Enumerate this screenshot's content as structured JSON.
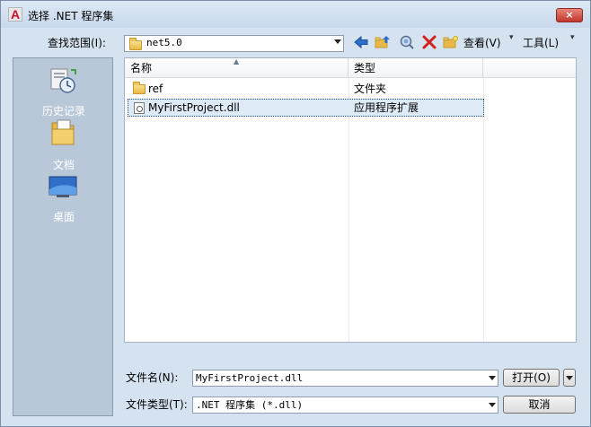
{
  "window": {
    "title": "选择 .NET 程序集",
    "close_icon": "×"
  },
  "lookin": {
    "label": "查找范围(I):",
    "value": "net5.0"
  },
  "toolbar": {
    "view_label": "查看(V)",
    "tools_label": "工具(L)"
  },
  "places": [
    {
      "label": "历史记录",
      "icon": "history-icon"
    },
    {
      "label": "文档",
      "icon": "documents-icon"
    },
    {
      "label": "桌面",
      "icon": "desktop-icon"
    }
  ],
  "filelist": {
    "columns": [
      "名称",
      "类型"
    ],
    "rows": [
      {
        "name": "ref",
        "type": "文件夹",
        "icon": "folder-icon"
      },
      {
        "name": "MyFirstProject.dll",
        "type": "应用程序扩展",
        "icon": "dll-file-icon",
        "selected": true
      }
    ]
  },
  "filename": {
    "label": "文件名(N):",
    "value": "MyFirstProject.dll"
  },
  "filetype": {
    "label": "文件类型(T):",
    "value": ".NET 程序集 (*.dll)"
  },
  "buttons": {
    "open": "打开(O)",
    "cancel": "取消"
  }
}
